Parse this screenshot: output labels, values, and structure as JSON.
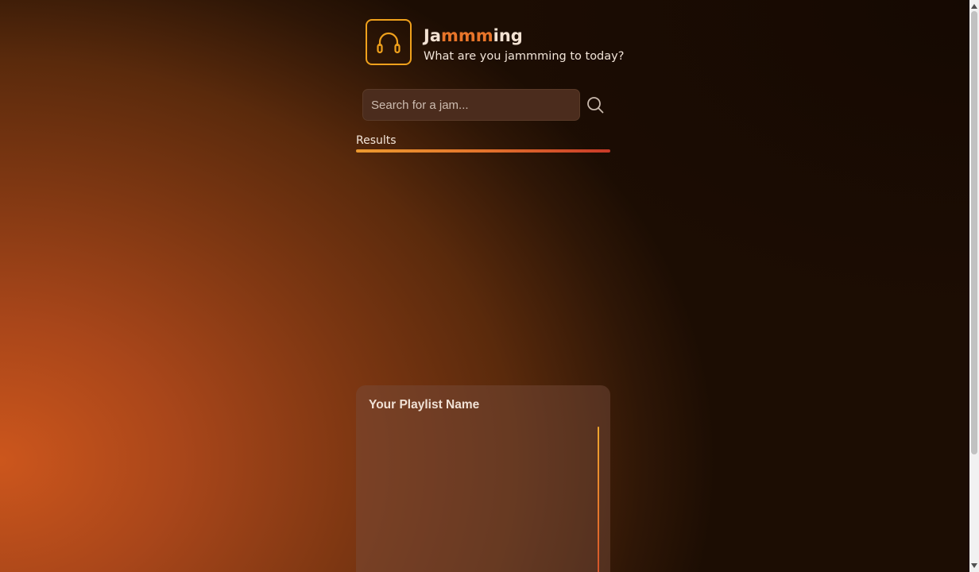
{
  "header": {
    "title_parts": [
      {
        "text": "Ja",
        "accent": false
      },
      {
        "text": "mmm",
        "accent": true
      },
      {
        "text": "ing",
        "accent": false
      }
    ],
    "tagline": "What are you jammming to today?",
    "logo_icon": "headphones-icon"
  },
  "search": {
    "placeholder": "Search for a jam...",
    "value": "",
    "button_icon": "search-icon"
  },
  "results": {
    "label": "Results",
    "items": []
  },
  "playlist": {
    "name": "Your Playlist Name",
    "tracks": []
  },
  "colors": {
    "accent_orange": "#e8752a",
    "logo_yellow": "#f0a11c",
    "bar_start": "#ec9a2f",
    "bar_end": "#c93a28"
  }
}
